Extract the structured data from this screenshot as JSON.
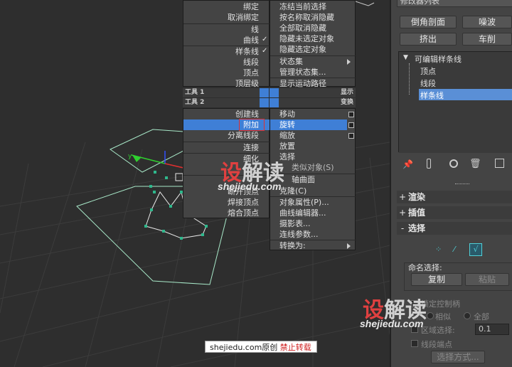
{
  "quad_left_top": {
    "items": [
      "绑定",
      "取消绑定",
      "线",
      "曲线",
      "样条线",
      "线段",
      "顶点",
      "顶层级"
    ],
    "checks": [
      "✓",
      "✓"
    ]
  },
  "quad_right_top": {
    "items": [
      "冻结当前选择",
      "按名称取消隐藏",
      "全部取消隐藏",
      "隐藏未选定对象",
      "隐藏选定对象",
      "状态集",
      "管理状态集...",
      "显示运动路径"
    ]
  },
  "quad_titles": {
    "tools1": "工具 1",
    "tools2": "工具 2",
    "display": "显示",
    "transform": "变换"
  },
  "quad_left_bottom": {
    "items": [
      "创建线",
      "附加",
      "分离线段",
      "连接",
      "细化",
      "",
      "",
      "断开顶点",
      "焊接顶点",
      "熔合顶点"
    ]
  },
  "quad_right_bottom": {
    "items": [
      "移动",
      "旋转",
      "缩放",
      "放置",
      "选择",
      "类似对象(S)",
      "轴曲面",
      "克隆(C)",
      "对象属性(P)...",
      "曲线编辑器...",
      "摄影表...",
      "连线参数...",
      "转换为:"
    ]
  },
  "cmd": {
    "header": "修改器列表",
    "buttons": [
      "倒角剖面",
      "噪波",
      "挤出",
      "车削"
    ],
    "stack_root": "可编辑样条线",
    "stack_items": [
      "顶点",
      "线段",
      "样条线"
    ],
    "stack_toggle": "▼",
    "toolbar_icons": [
      "pin-icon",
      "show-end-result-icon",
      "make-unique-icon",
      "remove-modifier-icon",
      "configure-sets-icon"
    ],
    "sections": [
      {
        "sign": "+",
        "label": "渲染"
      },
      {
        "sign": "+",
        "label": "插值"
      },
      {
        "sign": "-",
        "label": "选择"
      }
    ],
    "named_sel_label": "命名选择:",
    "copy_label": "复制",
    "paste_label": "粘贴",
    "control_label": "锁定控制柄",
    "similar_label": "相似",
    "all_label": "全部",
    "area_label": "区域选择:",
    "area_value": "0.1",
    "seg_end_label": "线段端点",
    "select_by_label": "选择方式..."
  },
  "watermark": {
    "logo_r": "设",
    "logo_w": "解读",
    "url": "shejiedu.com"
  },
  "credit": {
    "site": "shejiedu.com原创",
    "note": "禁止转载"
  },
  "colors": {
    "highlight": "#3f7fd6",
    "spline": "#a8e8c8",
    "vertex": "#2fb88c",
    "accent_red": "#e04040"
  }
}
